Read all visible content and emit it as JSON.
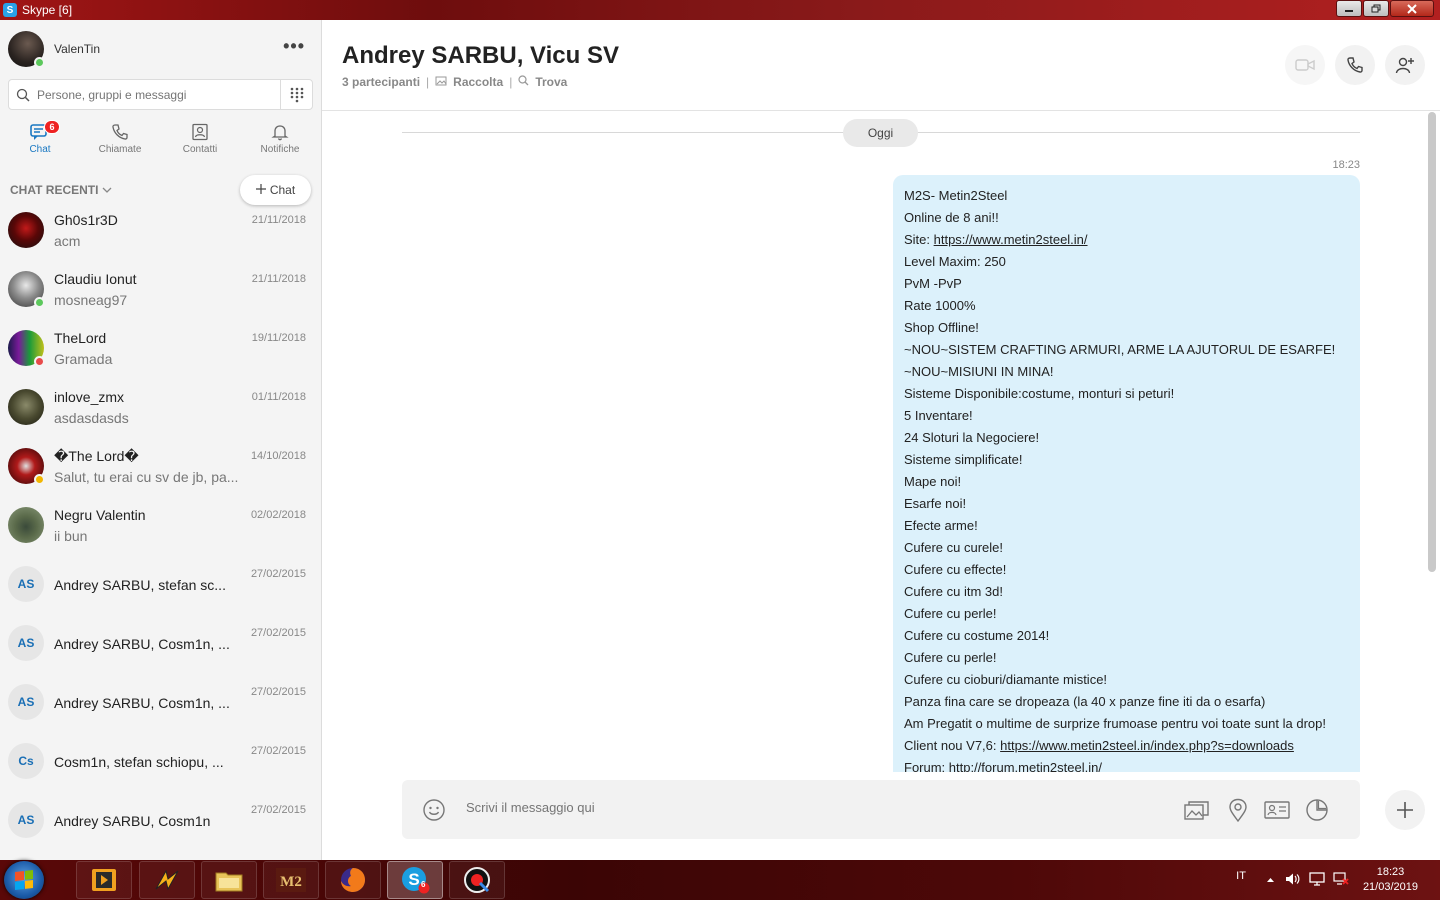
{
  "window": {
    "title": "Skype [6]",
    "app_icon": "S"
  },
  "profile": {
    "name": "ValenTin",
    "more": "•••"
  },
  "search": {
    "placeholder": "Persone, gruppi e messaggi"
  },
  "nav": {
    "tabs": [
      {
        "label": "Chat",
        "icon": "chat-icon",
        "badge": "6"
      },
      {
        "label": "Chiamate",
        "icon": "phone-icon"
      },
      {
        "label": "Contatti",
        "icon": "contacts-icon"
      },
      {
        "label": "Notifiche",
        "icon": "bell-icon"
      }
    ]
  },
  "recent": {
    "header": "CHAT RECENTI",
    "new_chat_label": "Chat"
  },
  "chats": [
    {
      "name": "Gh0s1r3D",
      "message": "acm",
      "date": "21/11/2018"
    },
    {
      "name": "Claudiu Ionut",
      "message": "mosneag97",
      "date": "21/11/2018"
    },
    {
      "name": "TheLord",
      "message": "Gramada",
      "date": "19/11/2018"
    },
    {
      "name": "inlove_zmx",
      "message": "asdasdasds",
      "date": "01/11/2018"
    },
    {
      "name": "�The Lord�",
      "message": "Salut, tu erai cu sv de jb, pa...",
      "date": "14/10/2018"
    },
    {
      "name": "Negru Valentin",
      "message": "ii bun",
      "date": "02/02/2018"
    },
    {
      "name": "Andrey SARBU, stefan sc...",
      "initials": "AS",
      "date": "27/02/2015"
    },
    {
      "name": "Andrey SARBU, Cosm1n, ...",
      "initials": "AS",
      "date": "27/02/2015"
    },
    {
      "name": "Andrey SARBU, Cosm1n, ...",
      "initials": "AS",
      "date": "27/02/2015"
    },
    {
      "name": "Cosm1n, stefan schiopu, ...",
      "initials": "Cs",
      "date": "27/02/2015"
    },
    {
      "name": "Andrey SARBU, Cosm1n",
      "initials": "AS",
      "date": "27/02/2015"
    }
  ],
  "conversation": {
    "title": "Andrey SARBU, Vicu SV",
    "participants": "3 partecipanti",
    "gallery": "Raccolta",
    "find": "Trova",
    "day": "Oggi",
    "time": "18:23",
    "message_lines": [
      "M2S- Metin2Steel",
      "Online de 8 ani!!",
      "Site: ",
      "Level Maxim: 250",
      "PvM -PvP",
      "Rate 1000%",
      "Shop Offline!",
      "~NOU~SISTEM CRAFTING ARMURI, ARME LA AJUTORUL DE ESARFE!",
      "~NOU~MISIUNI IN MINA!",
      "Sisteme Disponibile:costume, monturi si peturi!",
      "5 Inventare!",
      "24 Sloturi la Negociere!",
      "Sisteme simplificate!",
      "Mape noi!",
      "Esarfe noi!",
      "Efecte arme!",
      "Cufere cu curele!",
      "Cufere cu effecte!",
      "Cufere cu itm 3d!",
      "Cufere cu perle!",
      "Cufere cu costume 2014!",
      "Cufere cu perle!",
      "Cufere cu cioburi/diamante mistice!",
      "Panza fina care se dropeaza (la 40 x panze fine iti da o esarfa)",
      "Am Pregatit o multime de surprize frumoase pentru voi toate sunt la drop!",
      "Client nou V7,6: ",
      "Forum: http://forum.metin2steel.in/"
    ],
    "site_link": "https://www.metin2steel.in/",
    "client_link": "https://www.metin2steel.in/index.php?s=downloads"
  },
  "composer": {
    "placeholder": "Scrivi il messaggio qui"
  },
  "taskbar": {
    "language": "IT",
    "time": "18:23",
    "date": "21/03/2019",
    "skype_badge": "6"
  },
  "colors": {
    "accent": "#1a78c2",
    "bubble": "#dcf1fb",
    "badge": "#e22222",
    "online": "#5cc85c",
    "busy": "#e84a4a",
    "away": "#f2b600"
  }
}
